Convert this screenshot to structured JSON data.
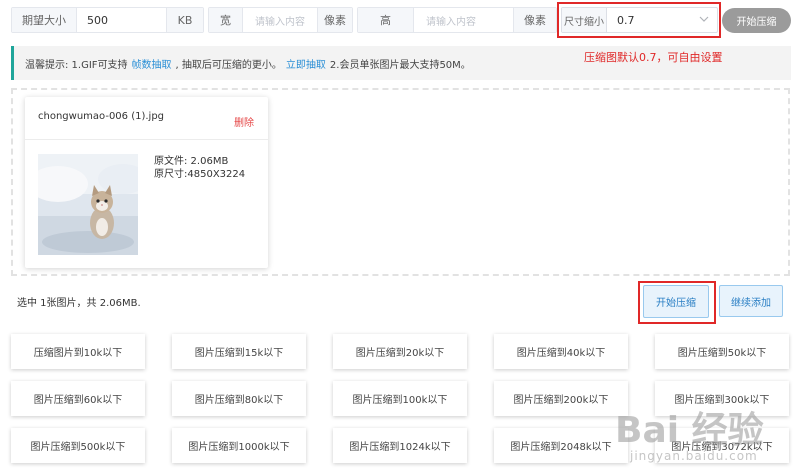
{
  "settings": {
    "expected_size_label": "期望大小",
    "expected_size_value": "500",
    "expected_size_unit": "KB",
    "width_label": "宽",
    "width_placeholder": "请输入内容",
    "width_unit": "像素",
    "height_label": "高",
    "height_placeholder": "请输入内容",
    "height_unit": "像素",
    "scale_label": "尺寸缩小",
    "scale_value": "0.7",
    "start_label": "开始压缩"
  },
  "tip": {
    "prefix": "温馨提示: 1.GIF可支持",
    "link1": "帧数抽取",
    "middle": ", 抽取后可压缩的更小。",
    "link2": "立即抽取",
    "suffix": "2.会员单张图片最大支持50M。"
  },
  "annotation": "压缩图默认0.7，可自由设置",
  "file": {
    "name": "chongwumao-006 (1).jpg",
    "delete_label": "删除",
    "original_size": "原文件: 2.06MB",
    "original_dims": "原尺寸:4850X3224"
  },
  "selection_summary": "选中 1张图片，共 2.06MB.",
  "actions": {
    "start": "开始压缩",
    "add_more": "继续添加"
  },
  "presets": [
    "压缩图片到10k以下",
    "图片压缩到15k以下",
    "图片压缩到20k以下",
    "图片压缩到40k以下",
    "图片压缩到50k以下",
    "图片压缩到60k以下",
    "图片压缩到80k以下",
    "图片压缩到100k以下",
    "图片压缩到200k以下",
    "图片压缩到300k以下",
    "图片压缩到500k以下",
    "图片压缩到1000k以下",
    "图片压缩到1024k以下",
    "图片压缩到2048k以下",
    "图片压缩到3072k以下"
  ],
  "watermark": {
    "text": "Bai 经验",
    "sub": "jingyan.baidu.com"
  }
}
